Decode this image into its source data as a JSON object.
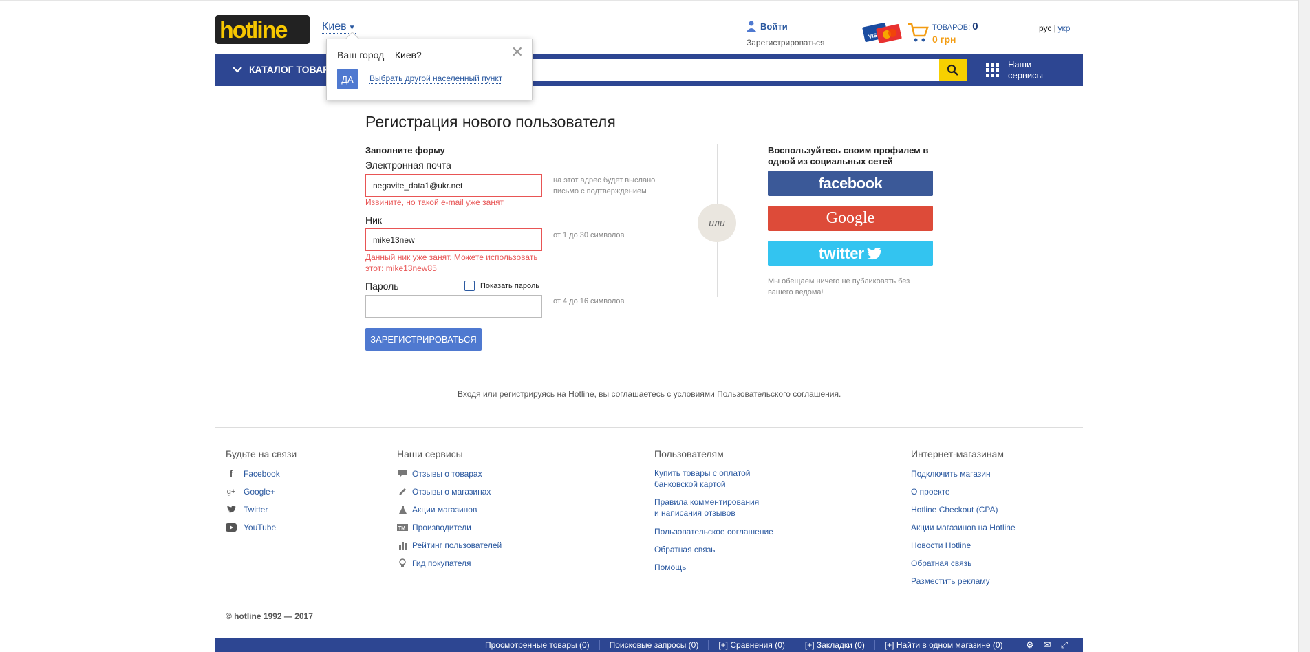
{
  "header": {
    "city": "Киев",
    "login": "Войти",
    "register": "Зарегистрироваться",
    "cart_label": "ТОВАРОВ:",
    "cart_count": "0",
    "cart_sum": "0 грн",
    "lang_ru": "рус",
    "lang_sep": "|",
    "lang_ua": "укр"
  },
  "nav": {
    "catalog": "КАТАЛОГ ТОВАРОВ",
    "services_line1": "Наши",
    "services_line2": "сервисы"
  },
  "city_popup": {
    "question_prefix": "Ваш город – ",
    "city": "Киев",
    "question_suffix": "?",
    "yes": "ДА",
    "other": "Выбрать другой населенный пункт",
    "close": "✕"
  },
  "form": {
    "title": "Регистрация нового пользователя",
    "subtitle": "Заполните форму",
    "email_label": "Электронная почта",
    "email_value": "negavite_data1@ukr.net",
    "email_hint": "на этот адрес будет выслано письмо с подтверждением",
    "email_error": "Извините, но такой e-mail уже занят",
    "nick_label": "Ник",
    "nick_value": "mike13new",
    "nick_hint": "от 1 до 30 символов",
    "nick_error": "Данный ник уже занят. Можете использовать этот: mike13new85",
    "password_label": "Пароль",
    "show_password": "Показать пароль",
    "password_value": "",
    "password_hint": "от 4 до 16 символов",
    "submit": "ЗАРЕГИСТРИРОВАТЬСЯ",
    "or": "или"
  },
  "social": {
    "title": "Воспользуйтесь своим профилем в одной из социальных сетей",
    "facebook": "facebook",
    "google": "Google",
    "twitter": "twitter",
    "note": "Мы обещаем ничего не публиковать без вашего ведома!"
  },
  "agreement": {
    "text": "Входя или регистрируясь на Hotline, вы соглашаетесь с условиями ",
    "link": "Пользовательского соглашения."
  },
  "footer": {
    "col1": {
      "title": "Будьте на связи",
      "items": [
        "Facebook",
        "Google+",
        "Twitter",
        "YouTube"
      ]
    },
    "col2": {
      "title": "Наши сервисы",
      "items": [
        "Отзывы о товарах",
        "Отзывы о магазинах",
        "Акции магазинов",
        "Производители",
        "Рейтинг пользователей",
        "Гид покупателя"
      ]
    },
    "col3": {
      "title": "Пользователям",
      "items": [
        {
          "l1": "Купить товары с оплатой",
          "l2": "банковской картой"
        },
        {
          "l1": "Правила комментирования",
          "l2": "и написания отзывов"
        },
        {
          "l1": "Пользовательское соглашение",
          "l2": ""
        },
        {
          "l1": "Обратная связь",
          "l2": ""
        },
        {
          "l1": "Помощь",
          "l2": ""
        }
      ]
    },
    "col4": {
      "title": "Интернет-магазинам",
      "items": [
        "Подключить магазин",
        "О проекте",
        "Hotline Checkout (CPA)",
        "Акции магазинов на Hotline",
        "Новости Hotline",
        "Обратная связь",
        "Разместить рекламу"
      ]
    },
    "copyright": "© hotline 1992 — 2017"
  },
  "bottom_bar": {
    "viewed": "Просмотренные товары (0)",
    "searches": "Поисковые запросы (0)",
    "compare": "[+] Сравнения (0)",
    "bookmarks": "[+] Закладки (0)",
    "one_shop": "[+] Найти в одном магазине (0)"
  },
  "colors": {
    "brand_blue": "#2d4692",
    "search_yellow": "#f7d000",
    "error_red": "#e85555",
    "button_blue": "#4f79d0",
    "facebook": "#3b5998",
    "google": "#dd4b39",
    "twitter": "#33c4f0"
  }
}
